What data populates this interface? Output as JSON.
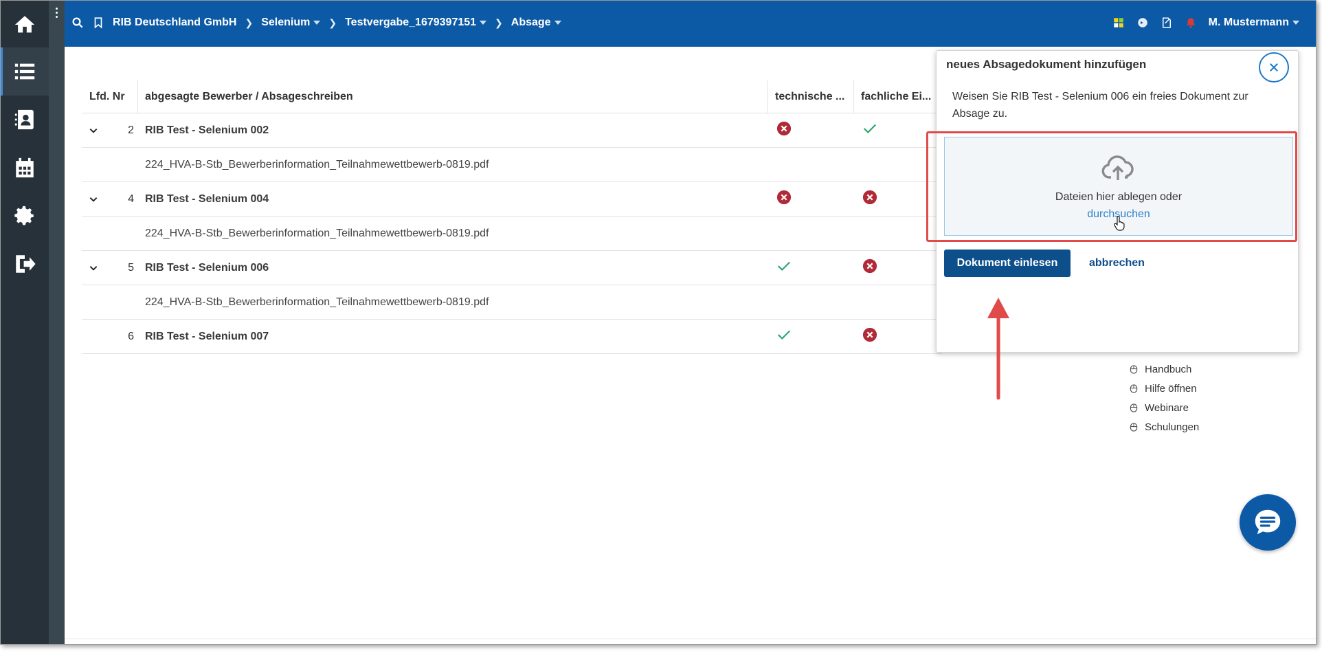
{
  "breadcrumb": {
    "items": [
      "RIB Deutschland GmbH",
      "Selenium",
      "Testvergabe_1679397151",
      "Absage"
    ]
  },
  "topbar": {
    "user": "M. Mustermann"
  },
  "table": {
    "headers": {
      "nr": "Lfd. Nr",
      "name": "abgesagte Bewerber / Absageschreiben",
      "tech": "technische ...",
      "fach": "fachliche Ei..."
    },
    "rows": [
      {
        "nr": "2",
        "name": "RIB Test - Selenium 002",
        "file": "224_HVA-B-Stb_Bewerberinformation_Teilnahmewettbewerb-0819.pdf",
        "tech": "error",
        "fach": "ok"
      },
      {
        "nr": "4",
        "name": "RIB Test - Selenium 004",
        "file": "224_HVA-B-Stb_Bewerberinformation_Teilnahmewettbewerb-0819.pdf",
        "tech": "error",
        "fach": "error"
      },
      {
        "nr": "5",
        "name": "RIB Test - Selenium 006",
        "file": "224_HVA-B-Stb_Bewerberinformation_Teilnahmewettbewerb-0819.pdf",
        "tech": "ok",
        "fach": "error"
      },
      {
        "nr": "6",
        "name": "RIB Test - Selenium 007",
        "tech": "ok",
        "fach": "error"
      }
    ]
  },
  "help": {
    "links": [
      "Handbuch",
      "Hilfe öffnen",
      "Webinare",
      "Schulungen"
    ]
  },
  "popup": {
    "title": "neues Absagedokument hinzufügen",
    "message": "Weisen Sie RIB Test - Selenium 006 ein freies Dokument zur Absage zu.",
    "dropzone_text": "Dateien hier ablegen oder",
    "dropzone_link": "durchsuchen",
    "primary_button": "Dokument einlesen",
    "cancel_button": "abbrechen"
  },
  "colors": {
    "topbar": "#0c5aa6",
    "sidebar": "#263139",
    "error_icon": "#b02a37",
    "ok_icon": "#2aa56e",
    "highlight": "#e04a4a"
  }
}
